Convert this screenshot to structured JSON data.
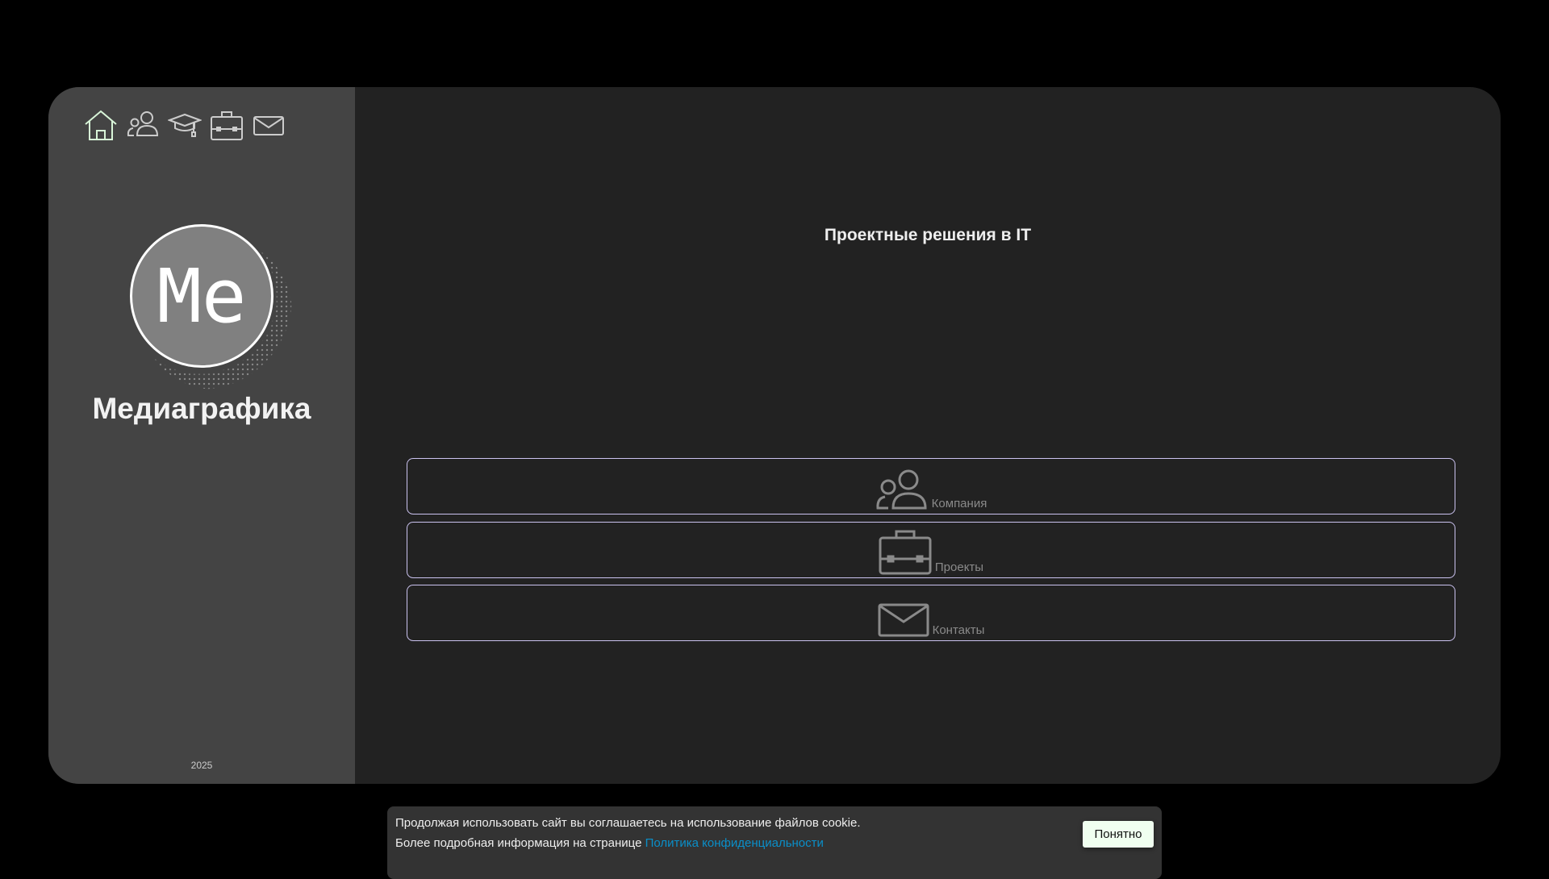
{
  "sidebar": {
    "nav": [
      "home-icon",
      "users-icon",
      "graduation-cap-icon",
      "briefcase-icon",
      "mail-icon"
    ],
    "avatar_text": "Me",
    "brand": "Медиаграфика",
    "year": "2025"
  },
  "main": {
    "heading": "Проектные решения в IT",
    "buttons": [
      {
        "label": "Компания",
        "icon": "users-icon"
      },
      {
        "label": "Проекты",
        "icon": "briefcase-icon"
      },
      {
        "label": "Контакты",
        "icon": "mail-icon"
      }
    ]
  },
  "cookie": {
    "line1": "Продолжая использовать сайт вы соглашаетесь на использование файлов cookie.",
    "line2": "Более подробная информация на странице",
    "link": "Политика конфиденциальности",
    "accept": "Понятно"
  },
  "colors": {
    "accent_border": "#cbc3f0",
    "link": "#0a8fc9",
    "home_icon": "#d8f5d8"
  }
}
